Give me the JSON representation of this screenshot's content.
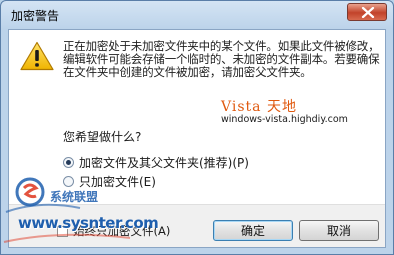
{
  "window": {
    "title": "加密警告"
  },
  "message": "正在加密处于未加密文件夹中的某个文件。如果此文件被修改，编辑软件可能会存储一个临时的、未加密的文件副本。若要确保在文件夹中创建的文件被加密，请加密父文件夹。",
  "watermark": {
    "brand": "Vista 天地",
    "url": "windows-vista.highdiy.com"
  },
  "question": "您希望做什么?",
  "options": [
    {
      "label": "加密文件及其父文件夹(推荐)(P)",
      "selected": true
    },
    {
      "label": "只加密文件(E)",
      "selected": false
    }
  ],
  "remember": {
    "label": "始终只加密文件(A)",
    "checked": false
  },
  "buttons": {
    "ok": "确定",
    "cancel": "取消"
  },
  "logo": {
    "text": "www.sysnter.com",
    "chinese": "系统联盟"
  },
  "colors": {
    "frame": "#b9d3ea",
    "close": "#c2432a",
    "watermark_accent": "#e05a10",
    "logo_blue": "#1f5fae"
  },
  "icons": {
    "title_close": "close-icon",
    "message": "warning-icon",
    "logo": "logo-mark"
  }
}
